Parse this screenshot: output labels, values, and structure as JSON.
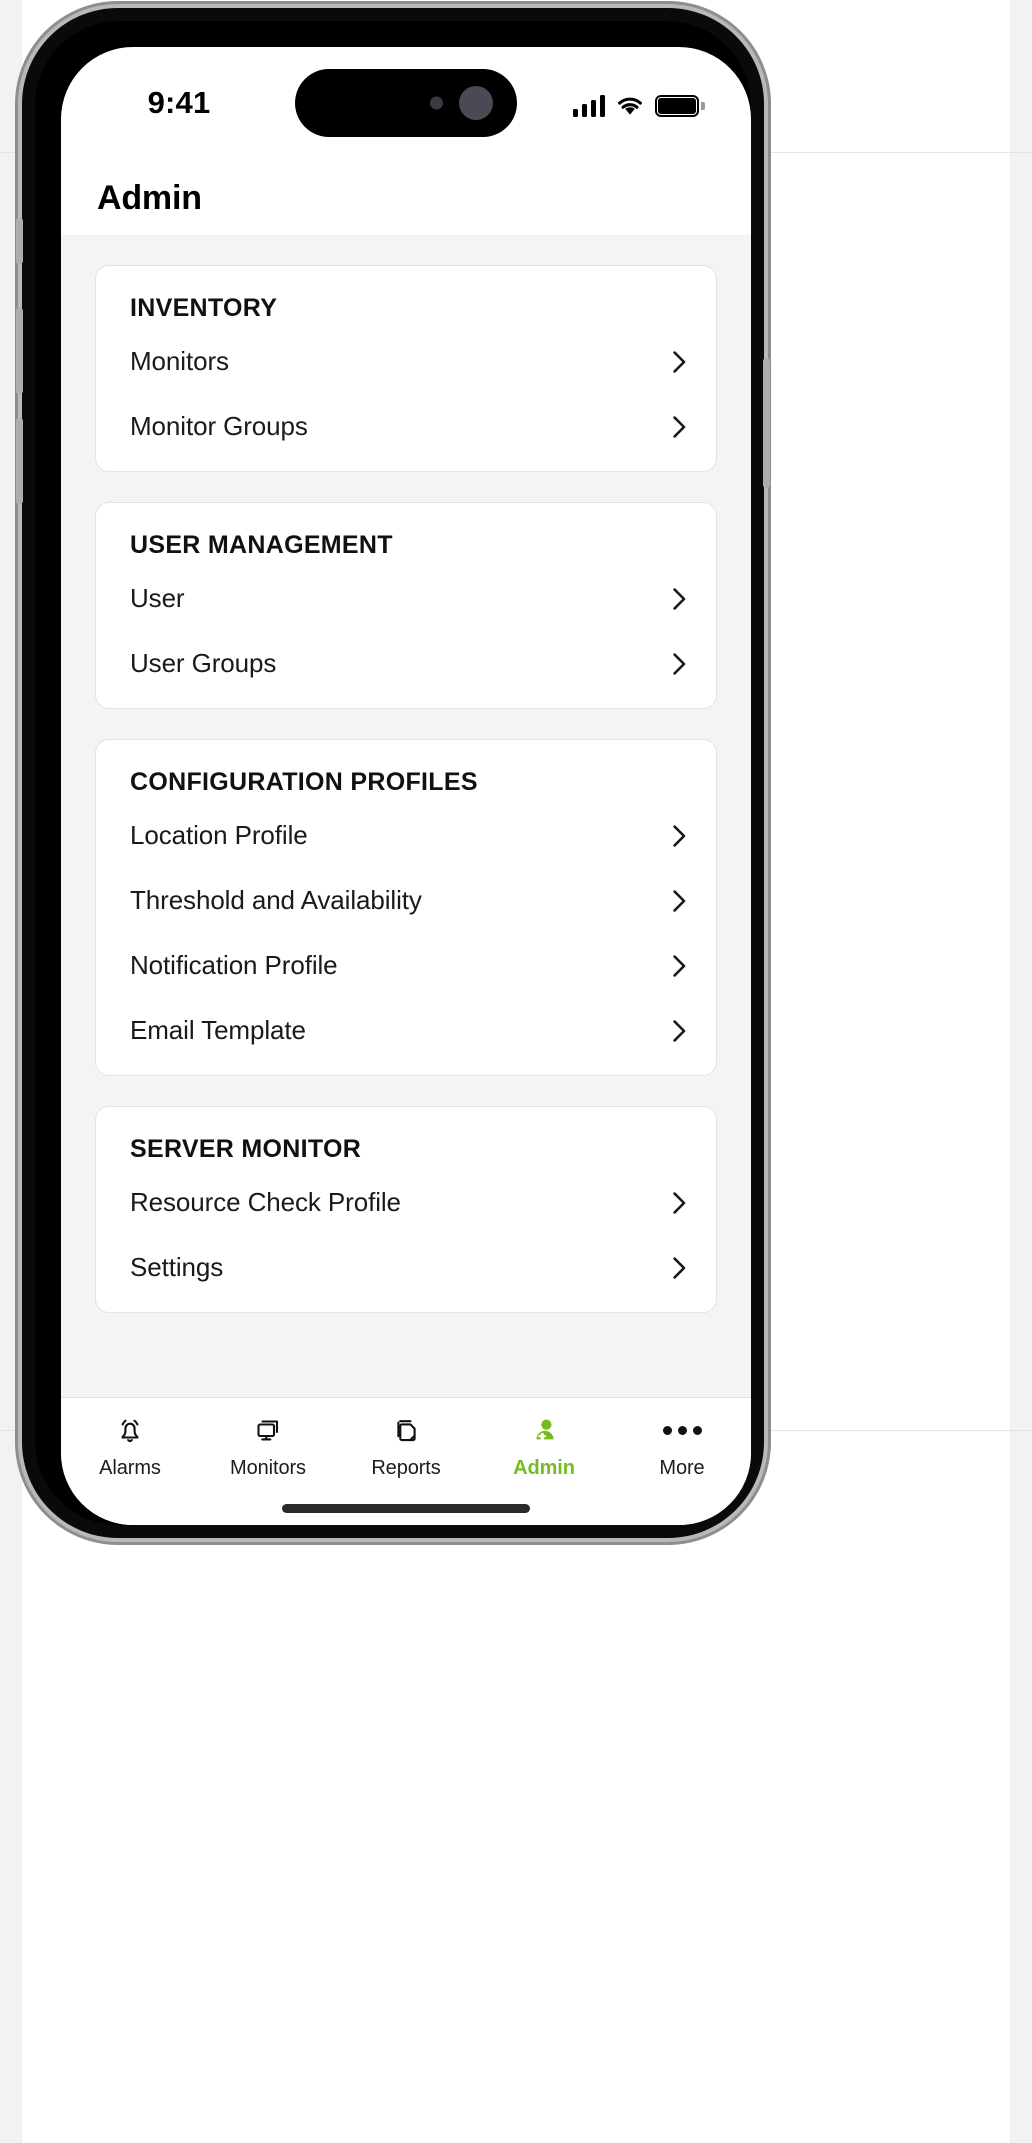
{
  "status_bar": {
    "time": "9:41",
    "signal_icon": "cellular-signal-icon",
    "wifi_icon": "wifi-icon",
    "battery_icon": "battery-full-icon"
  },
  "header": {
    "title": "Admin"
  },
  "colors": {
    "accent_green": "#76bc21",
    "page_background": "#f4f4f4",
    "card_background": "#ffffff",
    "card_border": "#e3e3e3",
    "text_primary": "#1a1a1a"
  },
  "sections": [
    {
      "title": "INVENTORY",
      "rows": [
        {
          "label": "Monitors",
          "chevron": "chevron-right-icon"
        },
        {
          "label": "Monitor Groups",
          "chevron": "chevron-right-icon"
        }
      ]
    },
    {
      "title": "USER MANAGEMENT",
      "rows": [
        {
          "label": "User",
          "chevron": "chevron-right-icon"
        },
        {
          "label": "User Groups",
          "chevron": "chevron-right-icon"
        }
      ]
    },
    {
      "title": "CONFIGURATION PROFILES",
      "rows": [
        {
          "label": "Location Profile",
          "chevron": "chevron-right-icon"
        },
        {
          "label": "Threshold and Availability",
          "chevron": "chevron-right-icon"
        },
        {
          "label": "Notification Profile",
          "chevron": "chevron-right-icon"
        },
        {
          "label": "Email Template",
          "chevron": "chevron-right-icon"
        }
      ]
    },
    {
      "title": "SERVER MONITOR",
      "rows": [
        {
          "label": "Resource Check Profile",
          "chevron": "chevron-right-icon"
        },
        {
          "label": "Settings",
          "chevron": "chevron-right-icon"
        }
      ]
    }
  ],
  "tab_bar": {
    "items": [
      {
        "label": "Alarms",
        "icon": "bell-icon",
        "active": false
      },
      {
        "label": "Monitors",
        "icon": "monitor-icon",
        "active": false
      },
      {
        "label": "Reports",
        "icon": "documents-icon",
        "active": false
      },
      {
        "label": "Admin",
        "icon": "person-icon",
        "active": true
      },
      {
        "label": "More",
        "icon": "ellipsis-icon",
        "active": false
      }
    ]
  }
}
